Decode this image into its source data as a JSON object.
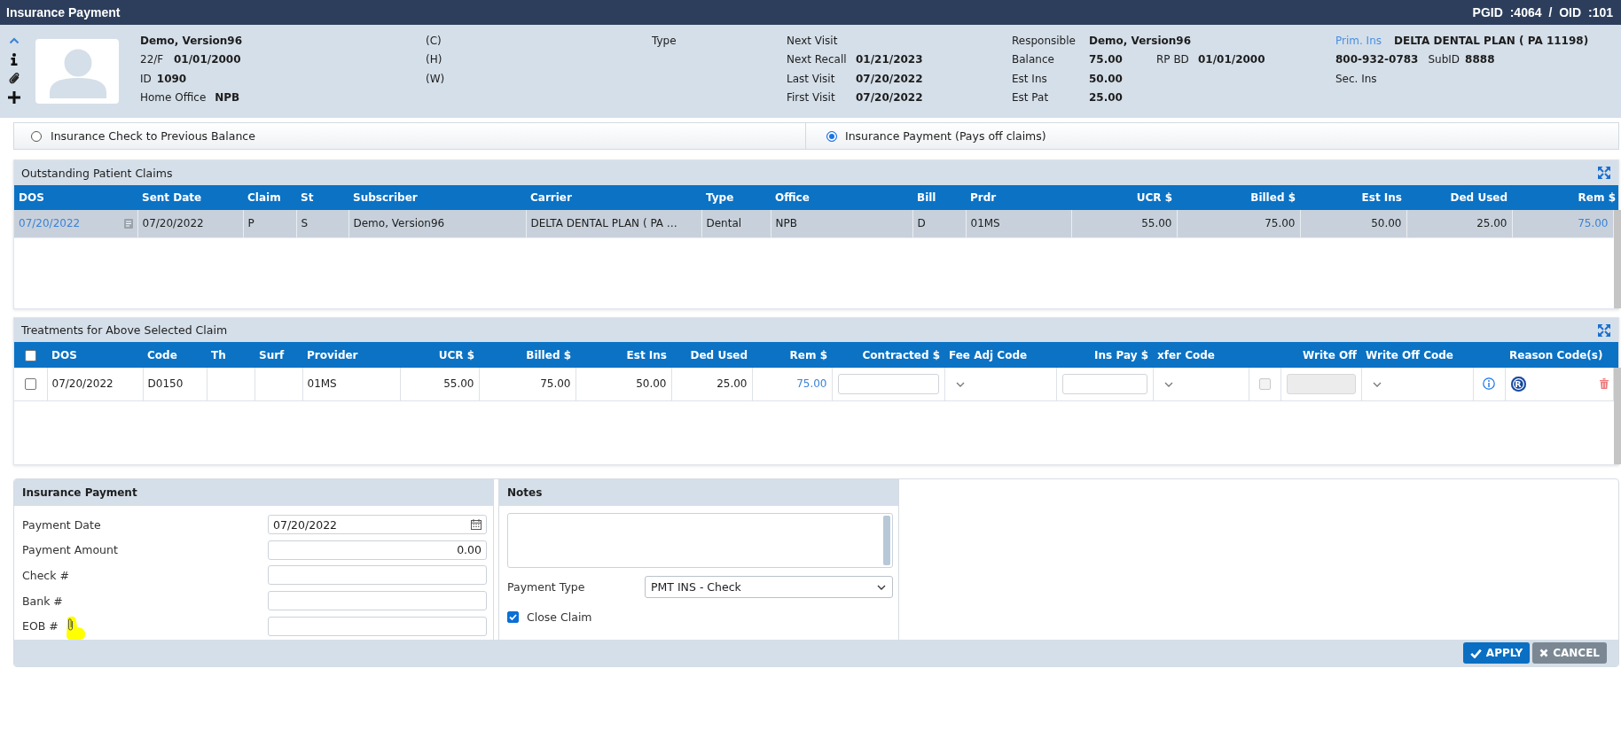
{
  "window": {
    "title": "Insurance Payment",
    "ids": "PGID :4064 / OID :101"
  },
  "patient": {
    "name": "Demo, Version96",
    "age_sex": "22/F",
    "birth_date": "01/01/2000",
    "id_label": "ID",
    "id": "1090",
    "office_label": "Home Office",
    "office": "NPB",
    "phones": [
      "(C)",
      "(H)",
      "(W)"
    ],
    "type_label": "Type"
  },
  "visits": [
    {
      "label": "Next Visit"
    },
    {
      "label": "Next Recall",
      "value": "01/21/2023"
    },
    {
      "label": "Last Visit",
      "value": "07/20/2022"
    },
    {
      "label": "First Visit",
      "value": "07/20/2022"
    }
  ],
  "account": [
    {
      "label": "Responsible",
      "value": "Demo, Version96"
    },
    {
      "label": "Balance",
      "value": "75.00",
      "extra_label": "RP BD",
      "extra_value": "01/01/2000"
    },
    {
      "label": "Est Ins",
      "value": "50.00"
    },
    {
      "label": "Est Pat",
      "value": "25.00"
    }
  ],
  "insurance": {
    "primary_label": "Prim. Ins",
    "primary_name": "DELTA DENTAL PLAN ( PA 11198)",
    "phone": "800-932-0783",
    "subid_label": "SubID",
    "subid": "8888",
    "secondary_label": "Sec. Ins"
  },
  "payment_modes": [
    {
      "label": "Insurance Check to Previous Balance",
      "selected": false
    },
    {
      "label": "Insurance Payment (Pays off claims)",
      "selected": true
    }
  ],
  "claims": {
    "title": "Outstanding Patient Claims",
    "columns": [
      {
        "label": "DOS",
        "kind": "link-note"
      },
      {
        "label": "Sent Date",
        "kind": "text"
      },
      {
        "label": "Claim",
        "kind": "text"
      },
      {
        "label": "St",
        "kind": "text"
      },
      {
        "label": "Subscriber",
        "kind": "text"
      },
      {
        "label": "Carrier",
        "kind": "text"
      },
      {
        "label": "Type",
        "kind": "text"
      },
      {
        "label": "Office",
        "kind": "text"
      },
      {
        "label": "Bill",
        "kind": "text"
      },
      {
        "label": "Prdr",
        "kind": "text"
      },
      {
        "label": "UCR $",
        "kind": "money"
      },
      {
        "label": "Billed $",
        "kind": "money"
      },
      {
        "label": "Est Ins",
        "kind": "money"
      },
      {
        "label": "Ded Used",
        "kind": "money"
      },
      {
        "label": "Rem $",
        "kind": "money-link"
      }
    ],
    "rows": [
      {
        "selected": true,
        "cells": [
          "07/20/2022",
          "07/20/2022",
          "P",
          "S",
          "Demo, Version96",
          "DELTA DENTAL PLAN ( PA …",
          "Dental",
          "NPB",
          "D",
          "01MS",
          "55.00",
          "75.00",
          "50.00",
          "25.00",
          "75.00"
        ]
      }
    ]
  },
  "treatments": {
    "title": "Treatments for Above Selected Claim",
    "columns": [
      {
        "kind": "check",
        "checked": false
      },
      {
        "label": "DOS",
        "kind": "text"
      },
      {
        "label": "Code",
        "kind": "text"
      },
      {
        "label": "Th",
        "kind": "text"
      },
      {
        "label": "Surf",
        "kind": "text"
      },
      {
        "label": "Provider",
        "kind": "text"
      },
      {
        "label": "UCR $",
        "kind": "money"
      },
      {
        "label": "Billed $",
        "kind": "money"
      },
      {
        "label": "Est Ins",
        "kind": "money"
      },
      {
        "label": "Ded Used",
        "kind": "money"
      },
      {
        "label": "Rem $",
        "kind": "money"
      },
      {
        "label": "Contracted $",
        "kind": "money"
      },
      {
        "label": "Fee Adj Code",
        "kind": "text"
      },
      {
        "label": "Ins Pay $",
        "kind": "money"
      },
      {
        "label": "xfer Code",
        "kind": "text"
      },
      {
        "kind": "blank"
      },
      {
        "label": "Write Off",
        "kind": "money"
      },
      {
        "label": "Write Off Code",
        "kind": "text"
      },
      {
        "kind": "blank"
      },
      {
        "label": "Reason Code(s)",
        "kind": "text"
      }
    ],
    "rows": [
      {
        "selected": false,
        "cells": [
          {
            "kind": "check",
            "checked": false
          },
          {
            "kind": "text",
            "text": "07/20/2022"
          },
          {
            "kind": "text",
            "text": "D0150"
          },
          {
            "kind": "blank"
          },
          {
            "kind": "blank"
          },
          {
            "kind": "text",
            "text": "01MS"
          },
          {
            "kind": "money",
            "text": "55.00"
          },
          {
            "kind": "money",
            "text": "75.00"
          },
          {
            "kind": "money",
            "text": "50.00"
          },
          {
            "kind": "money",
            "text": "25.00"
          },
          {
            "kind": "money-link",
            "text": "75.00"
          },
          {
            "kind": "input"
          },
          {
            "kind": "select"
          },
          {
            "kind": "input"
          },
          {
            "kind": "select"
          },
          {
            "kind": "check",
            "checked": false,
            "disabled": true
          },
          {
            "kind": "input",
            "disabled": true
          },
          {
            "kind": "select"
          },
          {
            "kind": "info"
          },
          {
            "kind": "reason",
            "badge": "R"
          }
        ]
      }
    ]
  },
  "payment": {
    "title": "Insurance Payment",
    "fields": [
      {
        "label": "Payment Date",
        "kind": "date",
        "value": "07/20/2022"
      },
      {
        "label": "Payment Amount",
        "kind": "amount",
        "value": "0.00"
      },
      {
        "label": "Check #",
        "kind": "text"
      },
      {
        "label": "Bank #",
        "kind": "text"
      },
      {
        "label": "EOB #",
        "kind": "text",
        "attachment": true,
        "highlighted": true
      }
    ]
  },
  "notes": {
    "title": "Notes",
    "payment_type_label": "Payment Type",
    "payment_type": "PMT INS - Check",
    "close_claim": {
      "label": "Close Claim",
      "checked": true
    }
  },
  "buttons": [
    {
      "label": "APPLY",
      "kind": "primary"
    },
    {
      "label": "CANCEL",
      "kind": "secondary"
    }
  ]
}
